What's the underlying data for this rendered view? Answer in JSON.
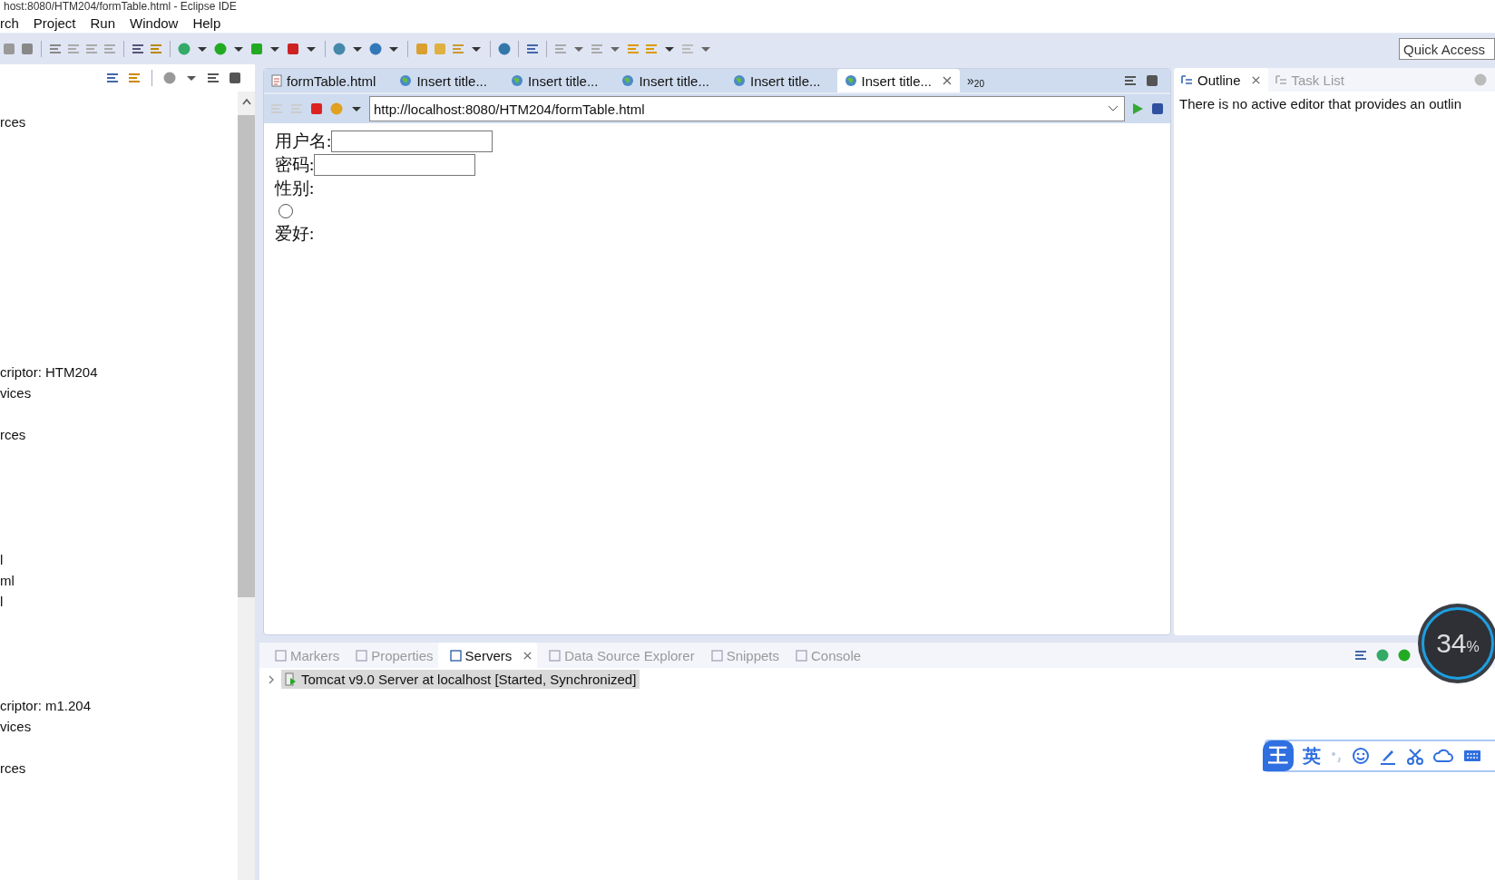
{
  "window": {
    "title": "host:8080/HTM204/formTable.html - Eclipse IDE"
  },
  "menu": [
    "rch",
    "Project",
    "Run",
    "Window",
    "Help"
  ],
  "quick_access": {
    "placeholder": "Quick Access"
  },
  "project_tree": {
    "rows": [
      "rces",
      "",
      "",
      "",
      "",
      "",
      "",
      "",
      "",
      "",
      "",
      "",
      "criptor: HTM204",
      "vices",
      "",
      "rces",
      "",
      "",
      "",
      "",
      "",
      "l",
      "ml",
      "l",
      "",
      "",
      "",
      "",
      "criptor: m1.204",
      "vices",
      "",
      "rces"
    ]
  },
  "editor_tabs": [
    {
      "label": "formTable.html",
      "kind": "file",
      "selected": false
    },
    {
      "label": "Insert title...",
      "kind": "web",
      "selected": false
    },
    {
      "label": "Insert title...",
      "kind": "web",
      "selected": false
    },
    {
      "label": "Insert title...",
      "kind": "web",
      "selected": false
    },
    {
      "label": "Insert title...",
      "kind": "web",
      "selected": false
    },
    {
      "label": "Insert title...",
      "kind": "web",
      "selected": true
    }
  ],
  "tab_overflow": {
    "symbol": "»",
    "count": "20"
  },
  "browser": {
    "url": "http://localhost:8080/HTM204/formTable.html"
  },
  "form": [
    {
      "kind": "input",
      "label": "用户名:"
    },
    {
      "kind": "input",
      "label": "密码:"
    },
    {
      "kind": "label",
      "label": "性别:"
    },
    {
      "kind": "radio",
      "checked": false
    },
    {
      "kind": "label",
      "label": "爱好:"
    }
  ],
  "outline_tabs": [
    {
      "label": "Outline",
      "selected": true
    },
    {
      "label": "Task List",
      "selected": false
    }
  ],
  "outline_message": "There is no active editor that provides an outlin",
  "bottom_tabs": [
    {
      "label": "Markers",
      "selected": false
    },
    {
      "label": "Properties",
      "selected": false
    },
    {
      "label": "Servers",
      "selected": true
    },
    {
      "label": "Data Source Explorer",
      "selected": false
    },
    {
      "label": "Snippets",
      "selected": false
    },
    {
      "label": "Console",
      "selected": false
    }
  ],
  "servers": [
    {
      "label": "Tomcat v9.0 Server at localhost  [Started, Synchronized]",
      "expanded": false,
      "selected": true
    }
  ],
  "memory_meter": {
    "value": "34",
    "unit": "%"
  },
  "ime_bar": {
    "logo": "王",
    "mode": "英"
  }
}
